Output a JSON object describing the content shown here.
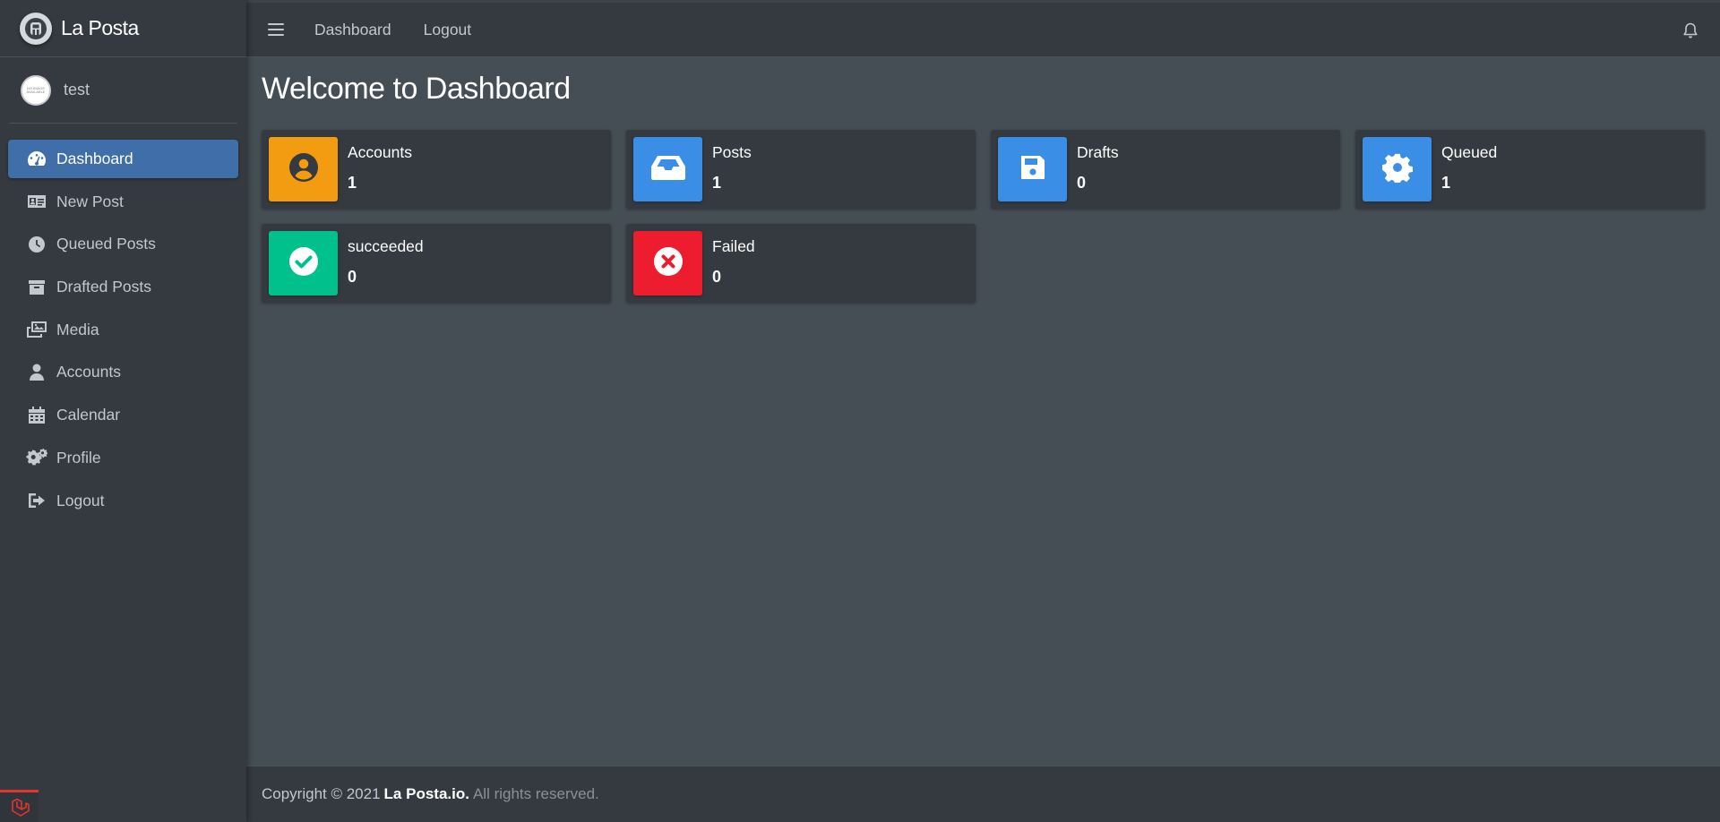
{
  "brand": {
    "name": "La Posta"
  },
  "user": {
    "name": "test",
    "avatar_text": "NO IMAGE AVAILABLE"
  },
  "sidebar": {
    "items": [
      {
        "label": "Dashboard",
        "icon": "tachometer-icon",
        "active": true
      },
      {
        "label": "New Post",
        "icon": "id-card-icon"
      },
      {
        "label": "Queued Posts",
        "icon": "clock-icon"
      },
      {
        "label": "Drafted Posts",
        "icon": "archive-icon"
      },
      {
        "label": "Media",
        "icon": "photo-video-icon"
      },
      {
        "label": "Accounts",
        "icon": "user-icon"
      },
      {
        "label": "Calendar",
        "icon": "calendar-icon"
      },
      {
        "label": "Profile",
        "icon": "cogs-icon"
      },
      {
        "label": "Logout",
        "icon": "sign-out-icon"
      }
    ]
  },
  "navbar": {
    "links": [
      "Dashboard",
      "Logout"
    ],
    "menu_icon": "hamburger-icon",
    "notification_icon": "bell-icon"
  },
  "main": {
    "title": "Welcome to Dashboard",
    "stats": [
      {
        "label": "Accounts",
        "value": "1",
        "color": "#f39c12",
        "icon": "user-circle-icon"
      },
      {
        "label": "Posts",
        "value": "1",
        "color": "#3a8ee6",
        "icon": "inbox-icon"
      },
      {
        "label": "Drafts",
        "value": "0",
        "color": "#3a8ee6",
        "icon": "save-icon"
      },
      {
        "label": "Queued",
        "value": "1",
        "color": "#3a8ee6",
        "icon": "cog-icon"
      },
      {
        "label": "succeeded",
        "value": "0",
        "color": "#00c08b",
        "icon": "check-circle-icon"
      },
      {
        "label": "Failed",
        "value": "0",
        "color": "#ed1c2e",
        "icon": "times-circle-icon"
      }
    ]
  },
  "footer": {
    "copyright": "Copyright © 2021",
    "brand": "La Posta.io.",
    "rights": "All rights reserved."
  },
  "colors": {
    "sidebar": "#343a40",
    "content": "#454d55",
    "active_nav": "#3f6ea8"
  }
}
